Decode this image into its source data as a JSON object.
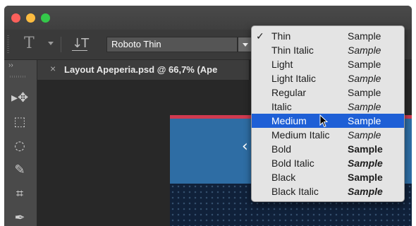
{
  "toolbar": {
    "type_tool_glyph": "T",
    "orientation_glyph": "↓T",
    "font_family_value": "Roboto Thin"
  },
  "document_tab": {
    "close_glyph": "×",
    "title": "Layout Apeperia.psd @ 66,7% (Ape"
  },
  "tools_panel": {
    "collapse_glyph": "››",
    "tools": [
      {
        "name": "move-tool-icon",
        "glyph": "▸✥"
      },
      {
        "name": "marquee-tool-icon",
        "glyph": "⬚"
      },
      {
        "name": "lasso-tool-icon",
        "glyph": "◌"
      },
      {
        "name": "quick-selection-tool-icon",
        "glyph": "✎"
      },
      {
        "name": "crop-tool-icon",
        "glyph": "⌗"
      },
      {
        "name": "eyedropper-tool-icon",
        "glyph": "✒"
      }
    ]
  },
  "canvas": {
    "arrow_glyph": "‹"
  },
  "font_style_menu": {
    "sample_label": "Sample",
    "checkmark": "✓",
    "selected": "Thin",
    "highlighted": "Medium",
    "items": [
      {
        "name": "Thin",
        "weight": 100,
        "italic": false
      },
      {
        "name": "Thin Italic",
        "weight": 100,
        "italic": true
      },
      {
        "name": "Light",
        "weight": 300,
        "italic": false
      },
      {
        "name": "Light Italic",
        "weight": 300,
        "italic": true
      },
      {
        "name": "Regular",
        "weight": 400,
        "italic": false
      },
      {
        "name": "Italic",
        "weight": 400,
        "italic": true
      },
      {
        "name": "Medium",
        "weight": 500,
        "italic": false
      },
      {
        "name": "Medium Italic",
        "weight": 500,
        "italic": true
      },
      {
        "name": "Bold",
        "weight": 700,
        "italic": false
      },
      {
        "name": "Bold Italic",
        "weight": 700,
        "italic": true
      },
      {
        "name": "Black",
        "weight": 900,
        "italic": false
      },
      {
        "name": "Black Italic",
        "weight": 900,
        "italic": true
      }
    ]
  },
  "colors": {
    "highlight": "#1e5fd6",
    "menu_bg": "#e4e4e4",
    "doc_blue": "#2e6da4",
    "doc_accent": "#d03a50"
  }
}
